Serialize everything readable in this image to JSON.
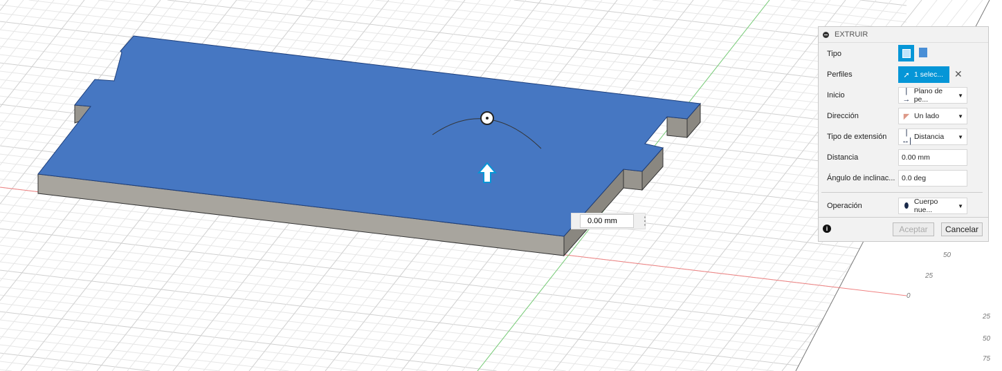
{
  "panel": {
    "title": "EXTRUIR",
    "rows": {
      "tipo": "Tipo",
      "perfiles": "Perfiles",
      "perfiles_value": "1 selec...",
      "inicio": "Inicio",
      "inicio_value": "Plano de pe...",
      "direccion": "Dirección",
      "direccion_value": "Un lado",
      "tipo_ext": "Tipo de extensión",
      "tipo_ext_value": "Distancia",
      "distancia": "Distancia",
      "distancia_value": "0.00 mm",
      "angulo": "Ángulo de inclinac...",
      "angulo_value": "0.0 deg",
      "operacion": "Operación",
      "operacion_value": "Cuerpo nue..."
    },
    "accept": "Aceptar",
    "cancel": "Cancelar"
  },
  "viewport": {
    "dimension_input": "0.00 mm",
    "axis_labels": [
      "50",
      "25",
      "0",
      "25",
      "50",
      "75"
    ],
    "colors": {
      "face": "#4677c2",
      "side": "#8a8780",
      "x_axis": "#e05050",
      "y_axis": "#40c040"
    }
  }
}
